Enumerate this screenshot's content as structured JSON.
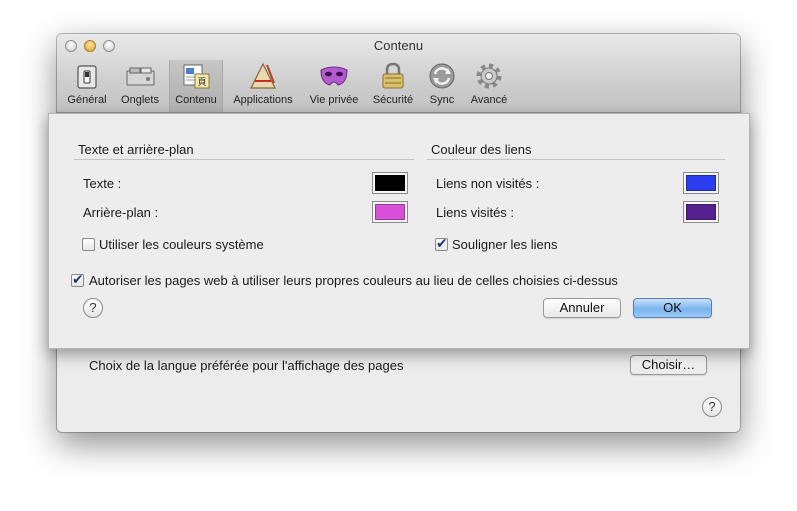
{
  "window": {
    "title": "Contenu",
    "toolbar": [
      {
        "label": "Général",
        "icon": "switch-icon"
      },
      {
        "label": "Onglets",
        "icon": "tabs-icon"
      },
      {
        "label": "Contenu",
        "icon": "content-icon",
        "selected": true
      },
      {
        "label": "Applications",
        "icon": "applications-icon"
      },
      {
        "label": "Vie privée",
        "icon": "privacy-mask-icon"
      },
      {
        "label": "Sécurité",
        "icon": "padlock-icon"
      },
      {
        "label": "Sync",
        "icon": "sync-icon"
      },
      {
        "label": "Avancé",
        "icon": "gear-icon"
      }
    ],
    "language": {
      "text": "Choix de la langue préférée pour l'affichage des pages",
      "button": "Choisir…"
    },
    "help": "?"
  },
  "sheet": {
    "text_section": {
      "title": "Texte et arrière-plan",
      "text_label": "Texte :",
      "text_color": "#000000",
      "background_label": "Arrière-plan :",
      "background_color": "#d84fd8",
      "system_colors_label": "Utiliser les couleurs système",
      "system_colors_checked": false
    },
    "links_section": {
      "title": "Couleur des liens",
      "unvisited_label": "Liens non visités :",
      "unvisited_color": "#2a3ef0",
      "visited_label": "Liens visités :",
      "visited_color": "#55208f",
      "underline_label": "Souligner les liens",
      "underline_checked": true
    },
    "allow_pages_label": "Autoriser les pages web à utiliser leurs propres couleurs au lieu de celles choisies ci-dessus",
    "allow_pages_checked": true,
    "help": "?",
    "cancel": "Annuler",
    "ok": "OK"
  }
}
